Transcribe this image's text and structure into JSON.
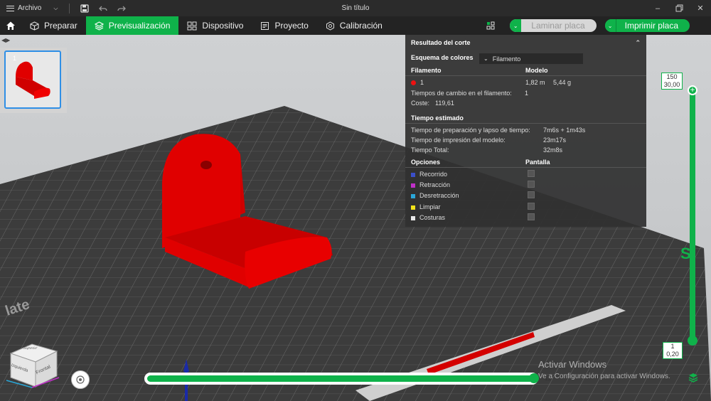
{
  "titlebar": {
    "menu_label": "Archivo",
    "title": "Sin título"
  },
  "tabs": [
    {
      "label": "Preparar"
    },
    {
      "label": "Previsualización"
    },
    {
      "label": "Dispositivo"
    },
    {
      "label": "Proyecto"
    },
    {
      "label": "Calibración"
    }
  ],
  "actions": {
    "slice_label": "Laminar placa",
    "print_label": "Imprimir placa"
  },
  "plate": {
    "thumbnail_number": "1"
  },
  "panel": {
    "title": "Resultado del corte",
    "color_scheme_label": "Esquema de colores",
    "color_scheme_value": "Filamento",
    "filament_header": "Filamento",
    "model_header": "Modelo",
    "filament_id": "1",
    "filament_length": "1,82 m",
    "filament_weight": "5,44 g",
    "change_times_label": "Tiempos de cambio en el filamento:",
    "change_times_value": "1",
    "cost_label": "Coste:",
    "cost_value": "119,61",
    "time_header": "Tiempo estimado",
    "prep_label": "Tiempo de preparación y lapso de tiempo:",
    "prep_value": "7m6s + 1m43s",
    "model_time_label": "Tiempo de impresión del modelo:",
    "model_time_value": "23m17s",
    "total_label": "Tiempo Total:",
    "total_value": "32m8s",
    "options_header": "Opciones",
    "display_header": "Pantalla",
    "options": [
      {
        "label": "Recorrido",
        "color": "#3b4fc9"
      },
      {
        "label": "Retracción",
        "color": "#c030c8"
      },
      {
        "label": "Desretracción",
        "color": "#2aa7d8"
      },
      {
        "label": "Limpiar",
        "color": "#f2e21a"
      },
      {
        "label": "Costuras",
        "color": "#e8e8e8"
      }
    ]
  },
  "layer_slider": {
    "top_layer": "150",
    "top_height": "30,00",
    "bottom_layer": "1",
    "bottom_height": "0,20"
  },
  "move_slider": {
    "value": "11"
  },
  "cube": {
    "top": "Superior",
    "left": "Izquierda",
    "front": "Frontal"
  },
  "watermark": {
    "line1": "Activar Windows",
    "line2": "Ve a Configuración para activar Windows."
  },
  "colors": {
    "accent": "#0fb24a",
    "model": "#e00000",
    "bed": "#3a3a3a"
  }
}
